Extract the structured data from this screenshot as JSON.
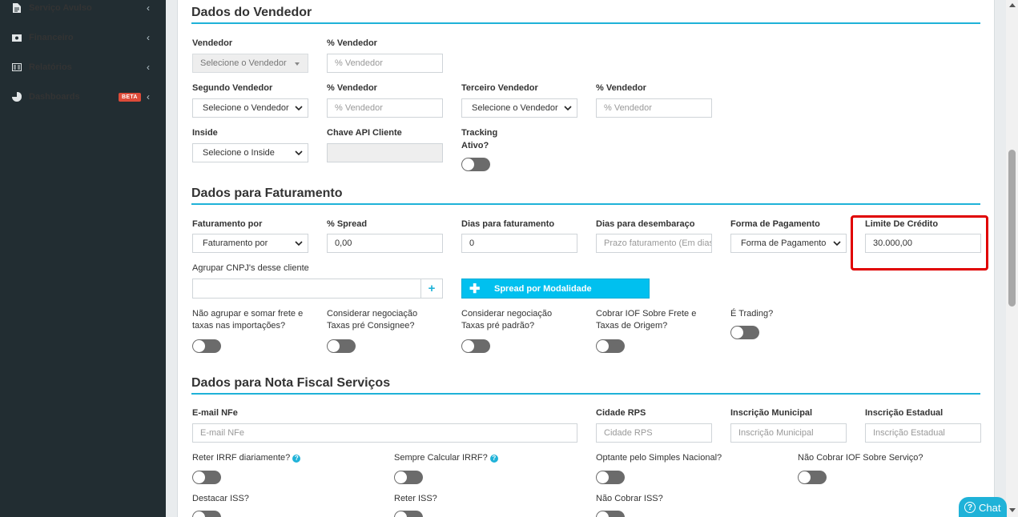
{
  "sidebar": {
    "items": [
      {
        "label": "Serviço Avulso",
        "icon": "file-icon"
      },
      {
        "label": "Financeiro",
        "icon": "money-icon"
      },
      {
        "label": "Relatórios",
        "icon": "report-icon"
      },
      {
        "label": "Dashboards",
        "icon": "pie-chart-icon",
        "badge": "BETA"
      }
    ]
  },
  "vendedor": {
    "title": "Dados do Vendedor",
    "vendedor_label": "Vendedor",
    "vendedor_value": "Selecione o Vendedor",
    "pct_vendedor_label": "% Vendedor",
    "pct_vendedor_placeholder": "% Vendedor",
    "segundo_label": "Segundo Vendedor",
    "segundo_value": "Selecione o Vendedor",
    "pct_segundo_label": "% Vendedor",
    "pct_segundo_placeholder": "% Vendedor",
    "terceiro_label": "Terceiro Vendedor",
    "terceiro_value": "Selecione o Vendedor",
    "pct_terceiro_label": "% Vendedor",
    "pct_terceiro_placeholder": "% Vendedor",
    "inside_label": "Inside",
    "inside_value": "Selecione o Inside",
    "chave_label": "Chave API Cliente",
    "tracking_label_1": "Tracking",
    "tracking_label_2": "Ativo?"
  },
  "faturamento": {
    "title": "Dados para Faturamento",
    "faturamento_por_label": "Faturamento por",
    "faturamento_por_value": "Faturamento por",
    "spread_label": "% Spread",
    "spread_value": "0,00",
    "dias_fat_label": "Dias para faturamento",
    "dias_fat_value": "0",
    "dias_desemb_label": "Dias para desembaraço",
    "dias_desemb_placeholder": "Prazo faturamento (Em dias)",
    "forma_pag_label": "Forma de Pagamento",
    "forma_pag_value": "Forma de Pagamento",
    "limite_label": "Limite De Crédito",
    "limite_value": "30.000,00",
    "agrupar_label": "Agrupar CNPJ's desse cliente",
    "spread_modalidade_button": "Spread por Modalidade",
    "toggle1_line1": "Não agrupar e somar frete e",
    "toggle1_line2": "taxas nas importações?",
    "toggle2_line1": "Considerar negociação",
    "toggle2_line2": "Taxas pré Consignee?",
    "toggle3_line1": "Considerar negociação",
    "toggle3_line2": "Taxas pré padrão?",
    "toggle4_line1": "Cobrar IOF Sobre Frete e",
    "toggle4_line2": "Taxas de Origem?",
    "toggle5_line1": "É Trading?"
  },
  "nota_fiscal": {
    "title": "Dados para Nota Fiscal Serviços",
    "email_label": "E-mail NFe",
    "email_placeholder": "E-mail NFe",
    "cidade_label": "Cidade RPS",
    "cidade_placeholder": "Cidade RPS",
    "insc_mun_label": "Inscrição Municipal",
    "insc_mun_placeholder": "Inscrição Municipal",
    "insc_est_label": "Inscrição Estadual",
    "insc_est_placeholder": "Inscrição Estadual",
    "reter_irrf_label": "Reter IRRF diariamente?",
    "sempre_irrf_label": "Sempre Calcular IRRF?",
    "optante_label": "Optante pelo Simples Nacional?",
    "nao_cobrar_iof_label": "Não Cobrar IOF Sobre Serviço?",
    "destacar_iss_label": "Destacar ISS?",
    "reter_iss_label": "Reter ISS?",
    "nao_cobrar_iss_label": "Não Cobrar ISS?"
  },
  "chat": {
    "label": "Chat"
  },
  "colors": {
    "accent": "#1fb2d8",
    "sidebar": "#222d32",
    "highlight": "#e00000",
    "badge": "#dd4b39"
  }
}
